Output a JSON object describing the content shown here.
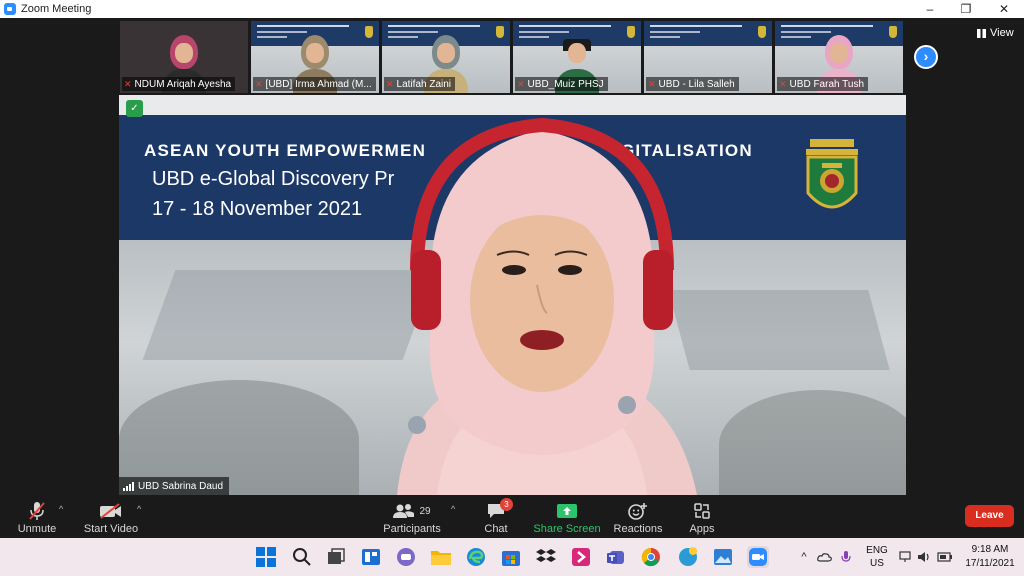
{
  "window": {
    "title": "Zoom Meeting",
    "minimize_icon": "–",
    "restore_icon": "❐",
    "close_icon": "✕"
  },
  "thumbnails": [
    {
      "name": "NDUM Ariqah Ayesha",
      "muted": true
    },
    {
      "name": "[UBD] Irma Ahmad (M...",
      "muted": true
    },
    {
      "name": "Latifah Zaini",
      "muted": true
    },
    {
      "name": "UBD_Muiz PHSJ",
      "muted": true
    },
    {
      "name": "UBD - Lila Salleh",
      "muted": true
    },
    {
      "name": "UBD Farah Tush",
      "muted": true
    }
  ],
  "view_label": "View",
  "next_page_icon": "›",
  "speaker": {
    "name": "UBD Sabrina Daud",
    "slide_line1_left": "ASEAN YOUTH EMPOWERMEN",
    "slide_line1_right": "GITALISATION",
    "slide_line2": "UBD e-Global Discovery Pr",
    "slide_line3": "17 - 18 November 2021"
  },
  "toolbar": {
    "unmute_label": "Unmute",
    "start_video_label": "Start Video",
    "participants_label": "Participants",
    "participants_count": "29",
    "chat_label": "Chat",
    "chat_badge": "3",
    "share_screen_label": "Share Screen",
    "reactions_label": "Reactions",
    "apps_label": "Apps",
    "leave_label": "Leave"
  },
  "taskbar": {
    "lang_top": "ENG",
    "lang_bottom": "US",
    "time": "9:18 AM",
    "date": "17/11/2021"
  },
  "colors": {
    "zoom_blue": "#2d8cff",
    "leave_red": "#d92d20",
    "share_green": "#2cc36b",
    "slide_navy": "#1c3867"
  }
}
